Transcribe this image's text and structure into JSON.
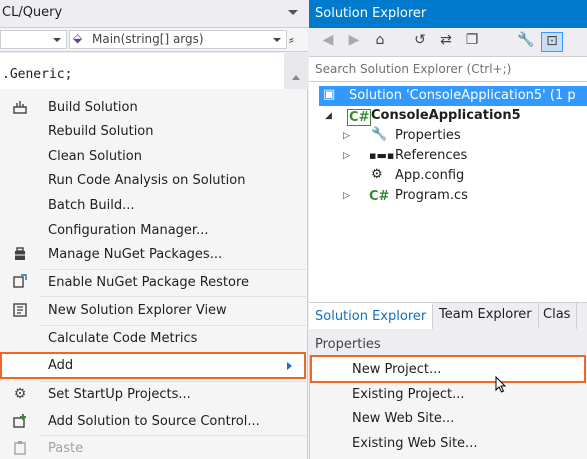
{
  "editor": {
    "title": "CL/Query",
    "nav_method_icon": "method-icon",
    "nav_method": "Main(string[] args)",
    "code_line": ".Generic;"
  },
  "context_menu": {
    "items": [
      {
        "label": "Build Solution",
        "icon": "build-icon"
      },
      {
        "label": "Rebuild Solution",
        "icon": ""
      },
      {
        "label": "Clean Solution",
        "icon": ""
      },
      {
        "label": "Run Code Analysis on Solution",
        "icon": ""
      },
      {
        "label": "Batch Build...",
        "icon": ""
      },
      {
        "label": "Configuration Manager...",
        "icon": ""
      },
      {
        "label": "Manage NuGet Packages...",
        "icon": "nuget-icon"
      },
      {
        "label": "Enable NuGet Package Restore",
        "icon": "package-restore-icon"
      },
      {
        "label": "New Solution Explorer View",
        "icon": "new-view-icon"
      },
      {
        "label": "Calculate Code Metrics",
        "icon": ""
      },
      {
        "label": "Add",
        "icon": "",
        "highlighted": true,
        "has_submenu": true
      },
      {
        "label": "Set StartUp Projects...",
        "icon": "gear-icon"
      },
      {
        "label": "Add Solution to Source Control...",
        "icon": "source-control-icon"
      },
      {
        "label": "Paste",
        "icon": "paste-icon",
        "disabled": true
      }
    ],
    "highlight_color": "#f26522"
  },
  "solution_explorer": {
    "title": "Solution Explorer",
    "title_bg": "#007acc",
    "toolbar_icons": [
      "back-icon",
      "forward-icon",
      "home-icon",
      "history-icon",
      "sync-icon",
      "collapse-all-icon",
      "properties-icon",
      "show-all-files-icon"
    ],
    "search_placeholder": "Search Solution Explorer (Ctrl+;)",
    "tree": {
      "solution": "Solution 'ConsoleApplication5' (1 p",
      "project": "ConsoleApplication5",
      "properties": "Properties",
      "references": "References",
      "app_config": "App.config",
      "program": "Program.cs"
    },
    "tabs": [
      "Solution Explorer",
      "Team Explorer",
      "Clas"
    ]
  },
  "properties": {
    "title": "Properties"
  },
  "submenu": {
    "items": [
      {
        "label": "New Project...",
        "highlighted": true
      },
      {
        "label": "Existing Project..."
      },
      {
        "label": "New Web Site..."
      },
      {
        "label": "Existing Web Site..."
      }
    ]
  }
}
